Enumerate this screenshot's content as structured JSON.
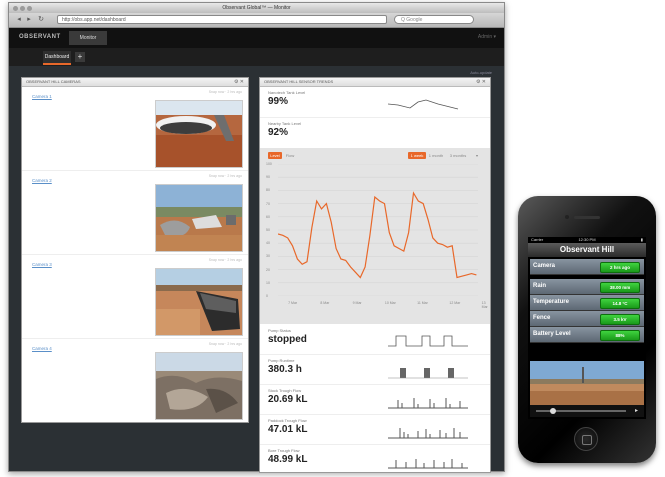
{
  "browser": {
    "window_title": "Observant Global™ — Monitor",
    "url": "http://obs.app.net/dashboard",
    "search_placeholder": "Q Google"
  },
  "app": {
    "logo": "OBSERVANT",
    "tab": "Monitor",
    "header_right": "Admin ▾",
    "subtab": "Dashboard",
    "add_tab": "+",
    "content_top": "Auto-update"
  },
  "cameras_panel": {
    "title": "OBSERVANT HILL CAMERAS",
    "items": [
      {
        "label": "Camera 1",
        "meta": "Snap now · 2 hrs ago"
      },
      {
        "label": "Camera 2",
        "meta": "Snap now · 2 hrs ago"
      },
      {
        "label": "Camera 3",
        "meta": "Snap now · 2 hrs ago"
      },
      {
        "label": "Camera 4",
        "meta": "Snap now · 2 hrs ago"
      }
    ]
  },
  "trends_panel": {
    "title": "OBSERVANT HILL SENSOR TRENDS",
    "top_metrics": [
      {
        "label": "Nanotech Tank Level",
        "value": "99%"
      },
      {
        "label": "Nearby Tank Level",
        "value": "92%"
      }
    ],
    "chart_buttons": {
      "left_active": "Level",
      "left_other": "Flow",
      "range_active": "1 week",
      "range_2": "1 month",
      "range_3": "3 months",
      "range_4": "▾"
    },
    "bottom_metrics": [
      {
        "label": "Pump Status",
        "value": "stopped"
      },
      {
        "label": "Pump Runtime",
        "value": "380.3 h"
      },
      {
        "label": "Stock Trough Flow",
        "value": "20.69 kL"
      },
      {
        "label": "Paddock Trough Flow",
        "value": "47.01 kL"
      },
      {
        "label": "Bore Trough Flow",
        "value": "48.99 kL"
      }
    ]
  },
  "chart_data": {
    "type": "line",
    "title": "",
    "xlabel": "",
    "ylabel": "",
    "ylim": [
      0,
      100
    ],
    "y_ticks": [
      "100",
      "90",
      "80",
      "70",
      "60",
      "50",
      "40",
      "30",
      "20",
      "10",
      "0"
    ],
    "x_ticks": [
      "7 Mar",
      "8 Mar",
      "9 Mar",
      "10 Mar",
      "11 Mar",
      "12 Mar",
      "13 Mar"
    ],
    "grid": true,
    "color": "#e8682a",
    "series": [
      {
        "name": "",
        "x": [
          0.0,
          0.15,
          0.3,
          0.45,
          0.6,
          0.75,
          0.9,
          1.05,
          1.2,
          1.35,
          1.5,
          1.65,
          1.8,
          1.95,
          2.1,
          2.25,
          2.4,
          2.55,
          2.7,
          2.85,
          3.0,
          3.15,
          3.3,
          3.45,
          3.6,
          3.75,
          3.9,
          4.05,
          4.2,
          4.35,
          4.5,
          4.65,
          4.8,
          4.95,
          5.1,
          5.25,
          5.4,
          5.55,
          5.7,
          5.85,
          6.0,
          6.15
        ],
        "values": [
          47,
          46,
          44,
          38,
          28,
          24,
          26,
          52,
          72,
          66,
          70,
          56,
          36,
          28,
          27,
          22,
          18,
          14,
          22,
          46,
          75,
          72,
          70,
          48,
          38,
          36,
          34,
          48,
          78,
          72,
          70,
          58,
          44,
          40,
          39,
          37,
          38,
          14,
          15,
          16,
          17,
          16
        ]
      }
    ]
  },
  "phone": {
    "status_left": "Carrier",
    "status_center": "12:30 PM",
    "title": "Observant Hill",
    "rows": [
      {
        "label": "Camera",
        "value": "2 hrs ago"
      },
      {
        "label": "Rain",
        "value": "38.00 mm"
      },
      {
        "label": "Temperature",
        "value": "14.8 °C"
      },
      {
        "label": "Fence",
        "value": "3.5 kV"
      },
      {
        "label": "Battery Level",
        "value": "88%"
      }
    ]
  }
}
